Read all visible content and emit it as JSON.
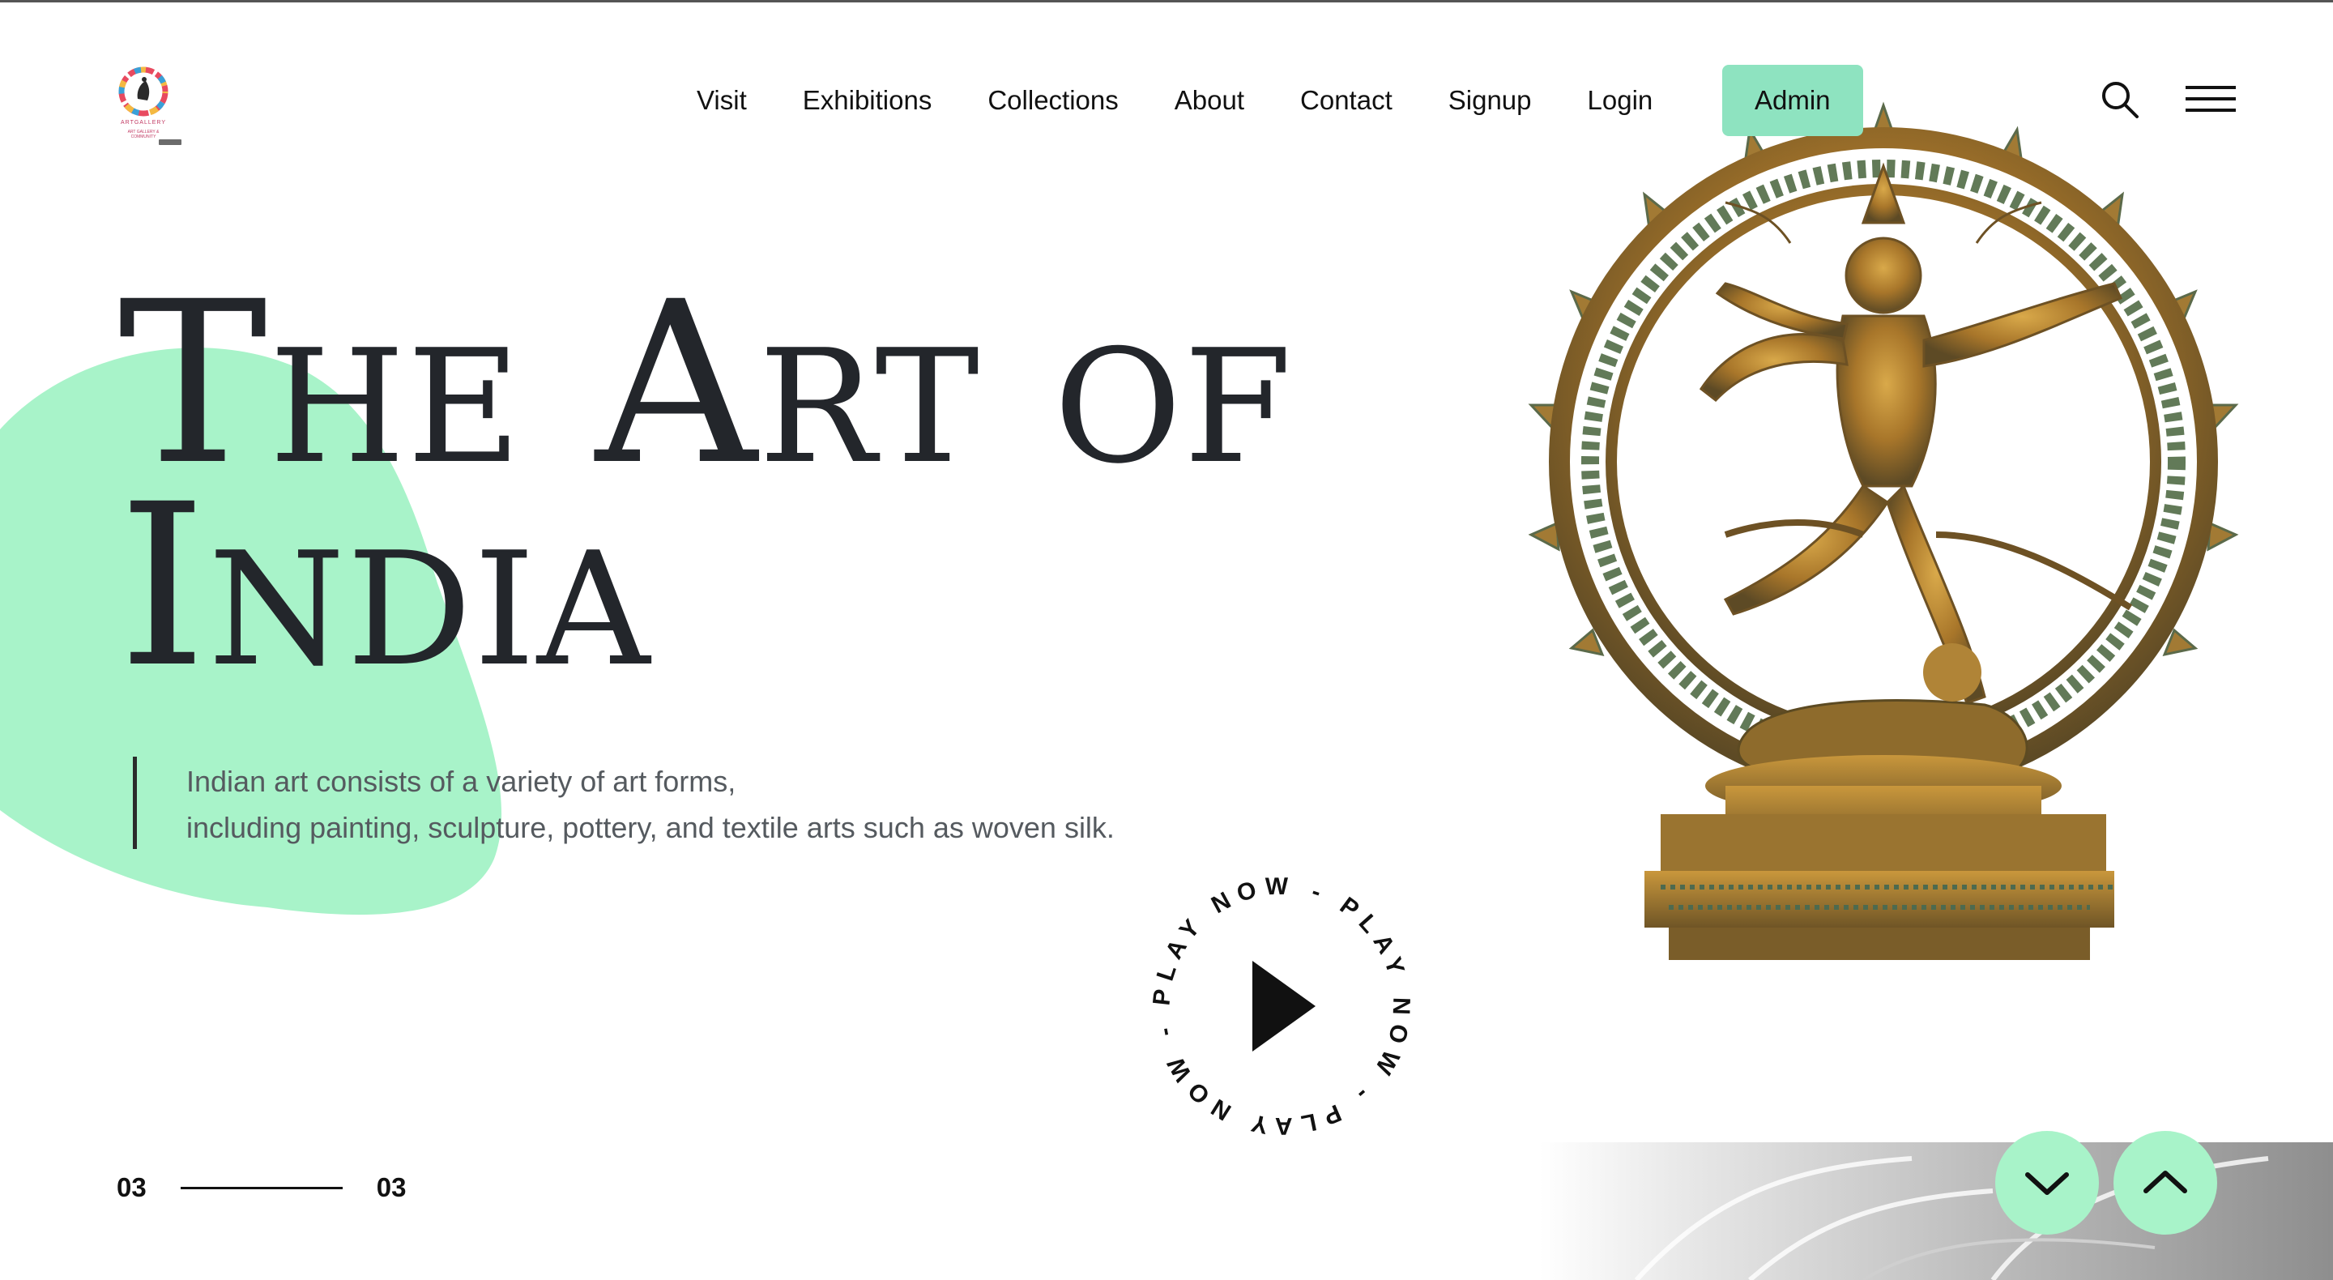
{
  "logo": {
    "icon": "circular-rainbow-logo",
    "tagline": "ARTGALLERY",
    "subline": "ART GALLERY & COMMUNITY"
  },
  "nav": {
    "items": [
      {
        "label": "Visit"
      },
      {
        "label": "Exhibitions"
      },
      {
        "label": "Collections"
      },
      {
        "label": "About"
      },
      {
        "label": "Contact"
      },
      {
        "label": "Signup"
      },
      {
        "label": "Login"
      }
    ],
    "admin_label": "Admin",
    "search_icon": "search-icon",
    "menu_icon": "hamburger-menu-icon"
  },
  "hero": {
    "title_line1": "The Art of",
    "title_line2": "India",
    "description_line1": "Indian art consists of a variety of art forms,",
    "description_line2": "including painting, sculpture, pottery, and textile arts such as woven silk."
  },
  "play": {
    "ring_text": "PLAY NOW - PLAY NOW - PLAY NOW - ",
    "icon": "play-icon"
  },
  "slider": {
    "current": "03",
    "total": "03"
  },
  "scroll": {
    "down_icon": "chevron-down-icon",
    "up_icon": "chevron-up-icon"
  },
  "colors": {
    "accent": "#8ee3c0",
    "blob": "#a8f3c9",
    "title": "#23262b",
    "text": "#555a5f"
  },
  "image": {
    "statue": "bronze-nataraja-statue"
  }
}
